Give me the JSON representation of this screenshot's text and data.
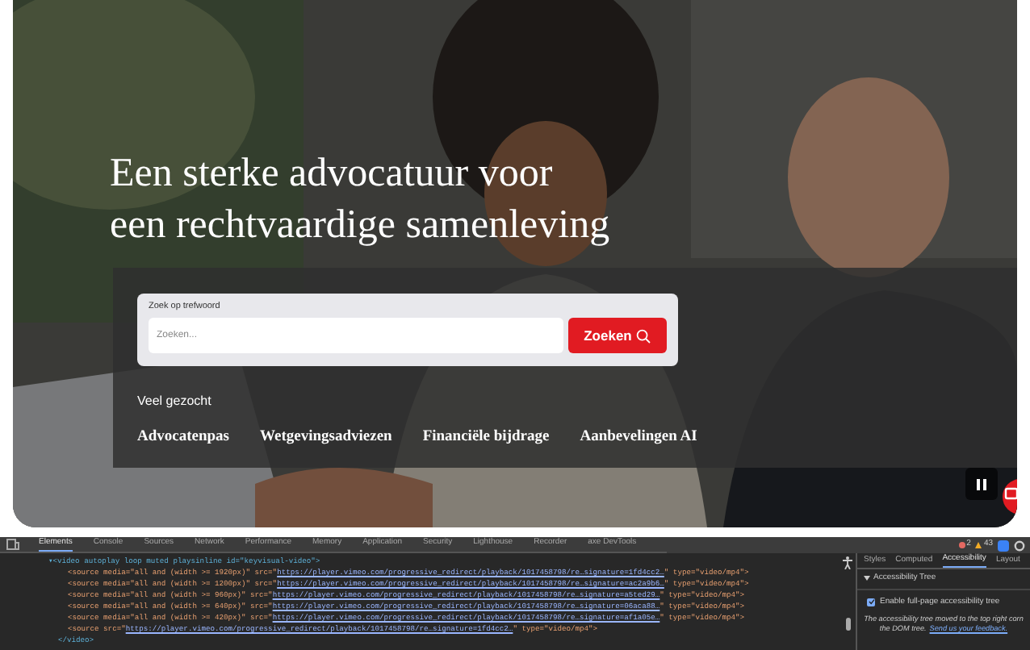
{
  "hero": {
    "title_lines": [
      "Een sterke advocatuur voor",
      "een rechtvaardige samenleving"
    ],
    "search": {
      "label": "Zoek op trefwoord",
      "placeholder": "Zoeken...",
      "button": "Zoeken"
    },
    "popular": {
      "heading": "Veel gezocht",
      "links": [
        "Advocatenpas",
        "Wetgevingsadviezen",
        "Financiële bijdrage",
        "Aanbevelingen AI"
      ]
    }
  },
  "devtools": {
    "tabs": [
      {
        "label": "Elements",
        "selected": true
      },
      {
        "label": "Console",
        "selected": false
      },
      {
        "label": "Sources",
        "selected": false
      },
      {
        "label": "Network",
        "selected": false
      },
      {
        "label": "Performance",
        "selected": false
      },
      {
        "label": "Memory",
        "selected": false
      },
      {
        "label": "Application",
        "selected": false
      },
      {
        "label": "Security",
        "selected": false
      },
      {
        "label": "Lighthouse",
        "selected": false
      },
      {
        "label": "Recorder",
        "selected": false
      },
      {
        "label": "axe DevTools",
        "selected": false
      }
    ],
    "errors": "2",
    "warnings": "43",
    "code_lines": [
      {
        "kind": "open",
        "text": "▾<video autoplay loop muted playsinline id=\"keyvisual-video\">"
      },
      {
        "kind": "source",
        "text": "<source media=\"all and (width >= 1920px)\" src=\"",
        "link": "https://player.vimeo.com/progressive_redirect/playback/1017458798/re…signature=1fd4cc2…",
        "end": "\" type=\"video/mp4\">"
      },
      {
        "kind": "source",
        "text": "<source media=\"all and (width >= 1200px)\" src=\"",
        "link": "https://player.vimeo.com/progressive_redirect/playback/1017458798/re…signature=ac2a9b6…",
        "end": "\" type=\"video/mp4\">"
      },
      {
        "kind": "source",
        "text": "<source media=\"all and (width >= 960px)\" src=\"",
        "link": "https://player.vimeo.com/progressive_redirect/playback/1017458798/re…signature=a5ted29…",
        "end": "\" type=\"video/mp4\">"
      },
      {
        "kind": "source",
        "text": "<source media=\"all and (width >= 640px)\" src=\"",
        "link": "https://player.vimeo.com/progressive_redirect/playback/1017458798/re…signature=06aca88…",
        "end": "\" type=\"video/mp4\">"
      },
      {
        "kind": "source",
        "text": "<source media=\"all and (width >= 420px)\" src=\"",
        "link": "https://player.vimeo.com/progressive_redirect/playback/1017458798/re…signature=af1a05e…",
        "end": "\" type=\"video/mp4\">"
      },
      {
        "kind": "source",
        "text": "<source src=\"",
        "link": "https://player.vimeo.com/progressive_redirect/playback/1017458798/re…signature=1fd4cc2…",
        "end": "\" type=\"video/mp4\">"
      },
      {
        "kind": "close",
        "text": "</video>"
      }
    ],
    "side_tabs": [
      {
        "label": "Styles",
        "selected": false
      },
      {
        "label": "Computed",
        "selected": false
      },
      {
        "label": "Accessibility",
        "selected": true
      },
      {
        "label": "Layout",
        "selected": false
      }
    ],
    "tree_heading": "Accessibility Tree",
    "enable_full_tree": {
      "label": "Enable full-page accessibility tree",
      "checked": true
    },
    "notice": {
      "line_1": "The accessibility tree moved to the top right corn",
      "line_2": "the DOM tree.",
      "link": "Send us your feedback."
    }
  }
}
